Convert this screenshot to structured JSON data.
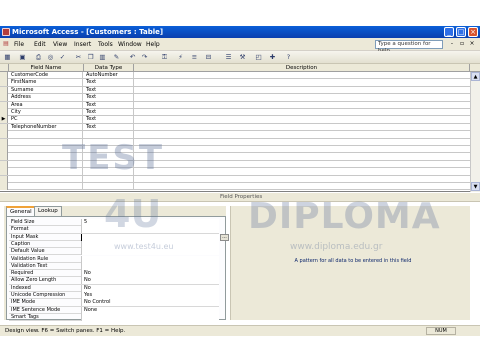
{
  "title": "Microsoft Access - [Customers : Table]",
  "window_buttons": {
    "minimize": "_",
    "maximize": "□",
    "close": "×"
  },
  "menu": [
    "File",
    "Edit",
    "View",
    "Insert",
    "Tools",
    "Window",
    "Help"
  ],
  "ask_placeholder": "Type a question for help",
  "doc_buttons": {
    "minimize": "-",
    "restore": "▫",
    "close": "×"
  },
  "grid": {
    "headers": {
      "field_name": "Field Name",
      "data_type": "Data Type",
      "description": "Description"
    },
    "fields": [
      {
        "name": "CustomerCode",
        "type": "AutoNumber"
      },
      {
        "name": "FirstName",
        "type": "Text"
      },
      {
        "name": "Surname",
        "type": "Text"
      },
      {
        "name": "Address",
        "type": "Text"
      },
      {
        "name": "Area",
        "type": "Text"
      },
      {
        "name": "City",
        "type": "Text"
      },
      {
        "name": "PC",
        "type": "Text",
        "current": true
      },
      {
        "name": "TelephoneNumber",
        "type": "Text"
      }
    ],
    "current_marker": "▶"
  },
  "field_properties": {
    "label": "Field Properties",
    "tabs": [
      "General",
      "Lookup"
    ],
    "rows": [
      {
        "label": "Field Size",
        "value": "5"
      },
      {
        "label": "Format",
        "value": ""
      },
      {
        "label": "Input Mask",
        "value": ""
      },
      {
        "label": "Caption",
        "value": ""
      },
      {
        "label": "Default Value",
        "value": ""
      },
      {
        "label": "Validation Rule",
        "value": ""
      },
      {
        "label": "Validation Text",
        "value": ""
      },
      {
        "label": "Required",
        "value": "No"
      },
      {
        "label": "Allow Zero Length",
        "value": "No"
      },
      {
        "label": "Indexed",
        "value": "No"
      },
      {
        "label": "Unicode Compression",
        "value": "Yes"
      },
      {
        "label": "IME Mode",
        "value": "No Control"
      },
      {
        "label": "IME Sentence Mode",
        "value": "None"
      },
      {
        "label": "Smart Tags",
        "value": ""
      }
    ],
    "builder_label": "...",
    "help_text": "A pattern for all data to be entered in this field"
  },
  "status": {
    "text": "Design view.  F6 = Switch panes.  F1 = Help.",
    "indicator": "NUM"
  },
  "watermark": {
    "brand1": "TEST",
    "brand2": "4U",
    "brand3": "DIPLOMA",
    "url1": "www.test4u.eu",
    "url2": "www.diploma.edu.gr"
  }
}
